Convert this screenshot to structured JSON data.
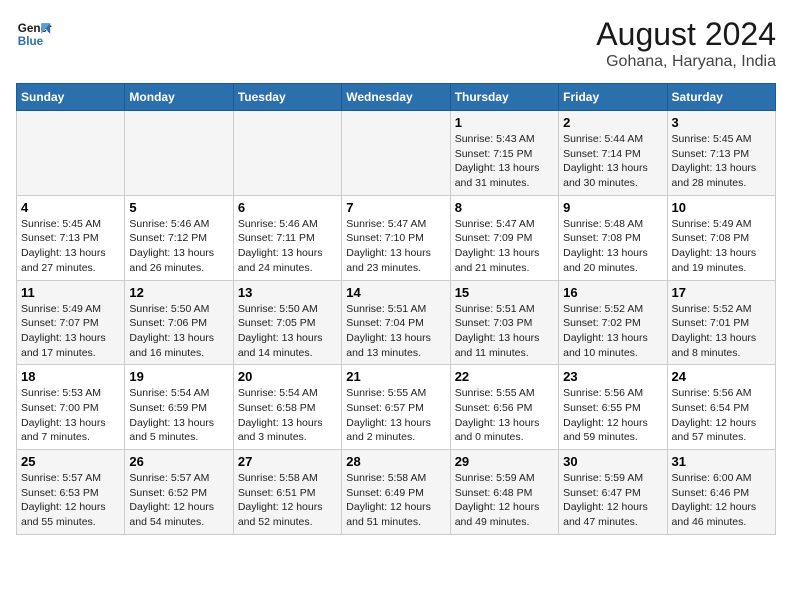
{
  "logo": {
    "line1": "General",
    "line2": "Blue"
  },
  "title": "August 2024",
  "subtitle": "Gohana, Haryana, India",
  "days_of_week": [
    "Sunday",
    "Monday",
    "Tuesday",
    "Wednesday",
    "Thursday",
    "Friday",
    "Saturday"
  ],
  "weeks": [
    [
      {
        "day": "",
        "info": ""
      },
      {
        "day": "",
        "info": ""
      },
      {
        "day": "",
        "info": ""
      },
      {
        "day": "",
        "info": ""
      },
      {
        "day": "1",
        "info": "Sunrise: 5:43 AM\nSunset: 7:15 PM\nDaylight: 13 hours and 31 minutes."
      },
      {
        "day": "2",
        "info": "Sunrise: 5:44 AM\nSunset: 7:14 PM\nDaylight: 13 hours and 30 minutes."
      },
      {
        "day": "3",
        "info": "Sunrise: 5:45 AM\nSunset: 7:13 PM\nDaylight: 13 hours and 28 minutes."
      }
    ],
    [
      {
        "day": "4",
        "info": "Sunrise: 5:45 AM\nSunset: 7:13 PM\nDaylight: 13 hours and 27 minutes."
      },
      {
        "day": "5",
        "info": "Sunrise: 5:46 AM\nSunset: 7:12 PM\nDaylight: 13 hours and 26 minutes."
      },
      {
        "day": "6",
        "info": "Sunrise: 5:46 AM\nSunset: 7:11 PM\nDaylight: 13 hours and 24 minutes."
      },
      {
        "day": "7",
        "info": "Sunrise: 5:47 AM\nSunset: 7:10 PM\nDaylight: 13 hours and 23 minutes."
      },
      {
        "day": "8",
        "info": "Sunrise: 5:47 AM\nSunset: 7:09 PM\nDaylight: 13 hours and 21 minutes."
      },
      {
        "day": "9",
        "info": "Sunrise: 5:48 AM\nSunset: 7:08 PM\nDaylight: 13 hours and 20 minutes."
      },
      {
        "day": "10",
        "info": "Sunrise: 5:49 AM\nSunset: 7:08 PM\nDaylight: 13 hours and 19 minutes."
      }
    ],
    [
      {
        "day": "11",
        "info": "Sunrise: 5:49 AM\nSunset: 7:07 PM\nDaylight: 13 hours and 17 minutes."
      },
      {
        "day": "12",
        "info": "Sunrise: 5:50 AM\nSunset: 7:06 PM\nDaylight: 13 hours and 16 minutes."
      },
      {
        "day": "13",
        "info": "Sunrise: 5:50 AM\nSunset: 7:05 PM\nDaylight: 13 hours and 14 minutes."
      },
      {
        "day": "14",
        "info": "Sunrise: 5:51 AM\nSunset: 7:04 PM\nDaylight: 13 hours and 13 minutes."
      },
      {
        "day": "15",
        "info": "Sunrise: 5:51 AM\nSunset: 7:03 PM\nDaylight: 13 hours and 11 minutes."
      },
      {
        "day": "16",
        "info": "Sunrise: 5:52 AM\nSunset: 7:02 PM\nDaylight: 13 hours and 10 minutes."
      },
      {
        "day": "17",
        "info": "Sunrise: 5:52 AM\nSunset: 7:01 PM\nDaylight: 13 hours and 8 minutes."
      }
    ],
    [
      {
        "day": "18",
        "info": "Sunrise: 5:53 AM\nSunset: 7:00 PM\nDaylight: 13 hours and 7 minutes."
      },
      {
        "day": "19",
        "info": "Sunrise: 5:54 AM\nSunset: 6:59 PM\nDaylight: 13 hours and 5 minutes."
      },
      {
        "day": "20",
        "info": "Sunrise: 5:54 AM\nSunset: 6:58 PM\nDaylight: 13 hours and 3 minutes."
      },
      {
        "day": "21",
        "info": "Sunrise: 5:55 AM\nSunset: 6:57 PM\nDaylight: 13 hours and 2 minutes."
      },
      {
        "day": "22",
        "info": "Sunrise: 5:55 AM\nSunset: 6:56 PM\nDaylight: 13 hours and 0 minutes."
      },
      {
        "day": "23",
        "info": "Sunrise: 5:56 AM\nSunset: 6:55 PM\nDaylight: 12 hours and 59 minutes."
      },
      {
        "day": "24",
        "info": "Sunrise: 5:56 AM\nSunset: 6:54 PM\nDaylight: 12 hours and 57 minutes."
      }
    ],
    [
      {
        "day": "25",
        "info": "Sunrise: 5:57 AM\nSunset: 6:53 PM\nDaylight: 12 hours and 55 minutes."
      },
      {
        "day": "26",
        "info": "Sunrise: 5:57 AM\nSunset: 6:52 PM\nDaylight: 12 hours and 54 minutes."
      },
      {
        "day": "27",
        "info": "Sunrise: 5:58 AM\nSunset: 6:51 PM\nDaylight: 12 hours and 52 minutes."
      },
      {
        "day": "28",
        "info": "Sunrise: 5:58 AM\nSunset: 6:49 PM\nDaylight: 12 hours and 51 minutes."
      },
      {
        "day": "29",
        "info": "Sunrise: 5:59 AM\nSunset: 6:48 PM\nDaylight: 12 hours and 49 minutes."
      },
      {
        "day": "30",
        "info": "Sunrise: 5:59 AM\nSunset: 6:47 PM\nDaylight: 12 hours and 47 minutes."
      },
      {
        "day": "31",
        "info": "Sunrise: 6:00 AM\nSunset: 6:46 PM\nDaylight: 12 hours and 46 minutes."
      }
    ]
  ]
}
